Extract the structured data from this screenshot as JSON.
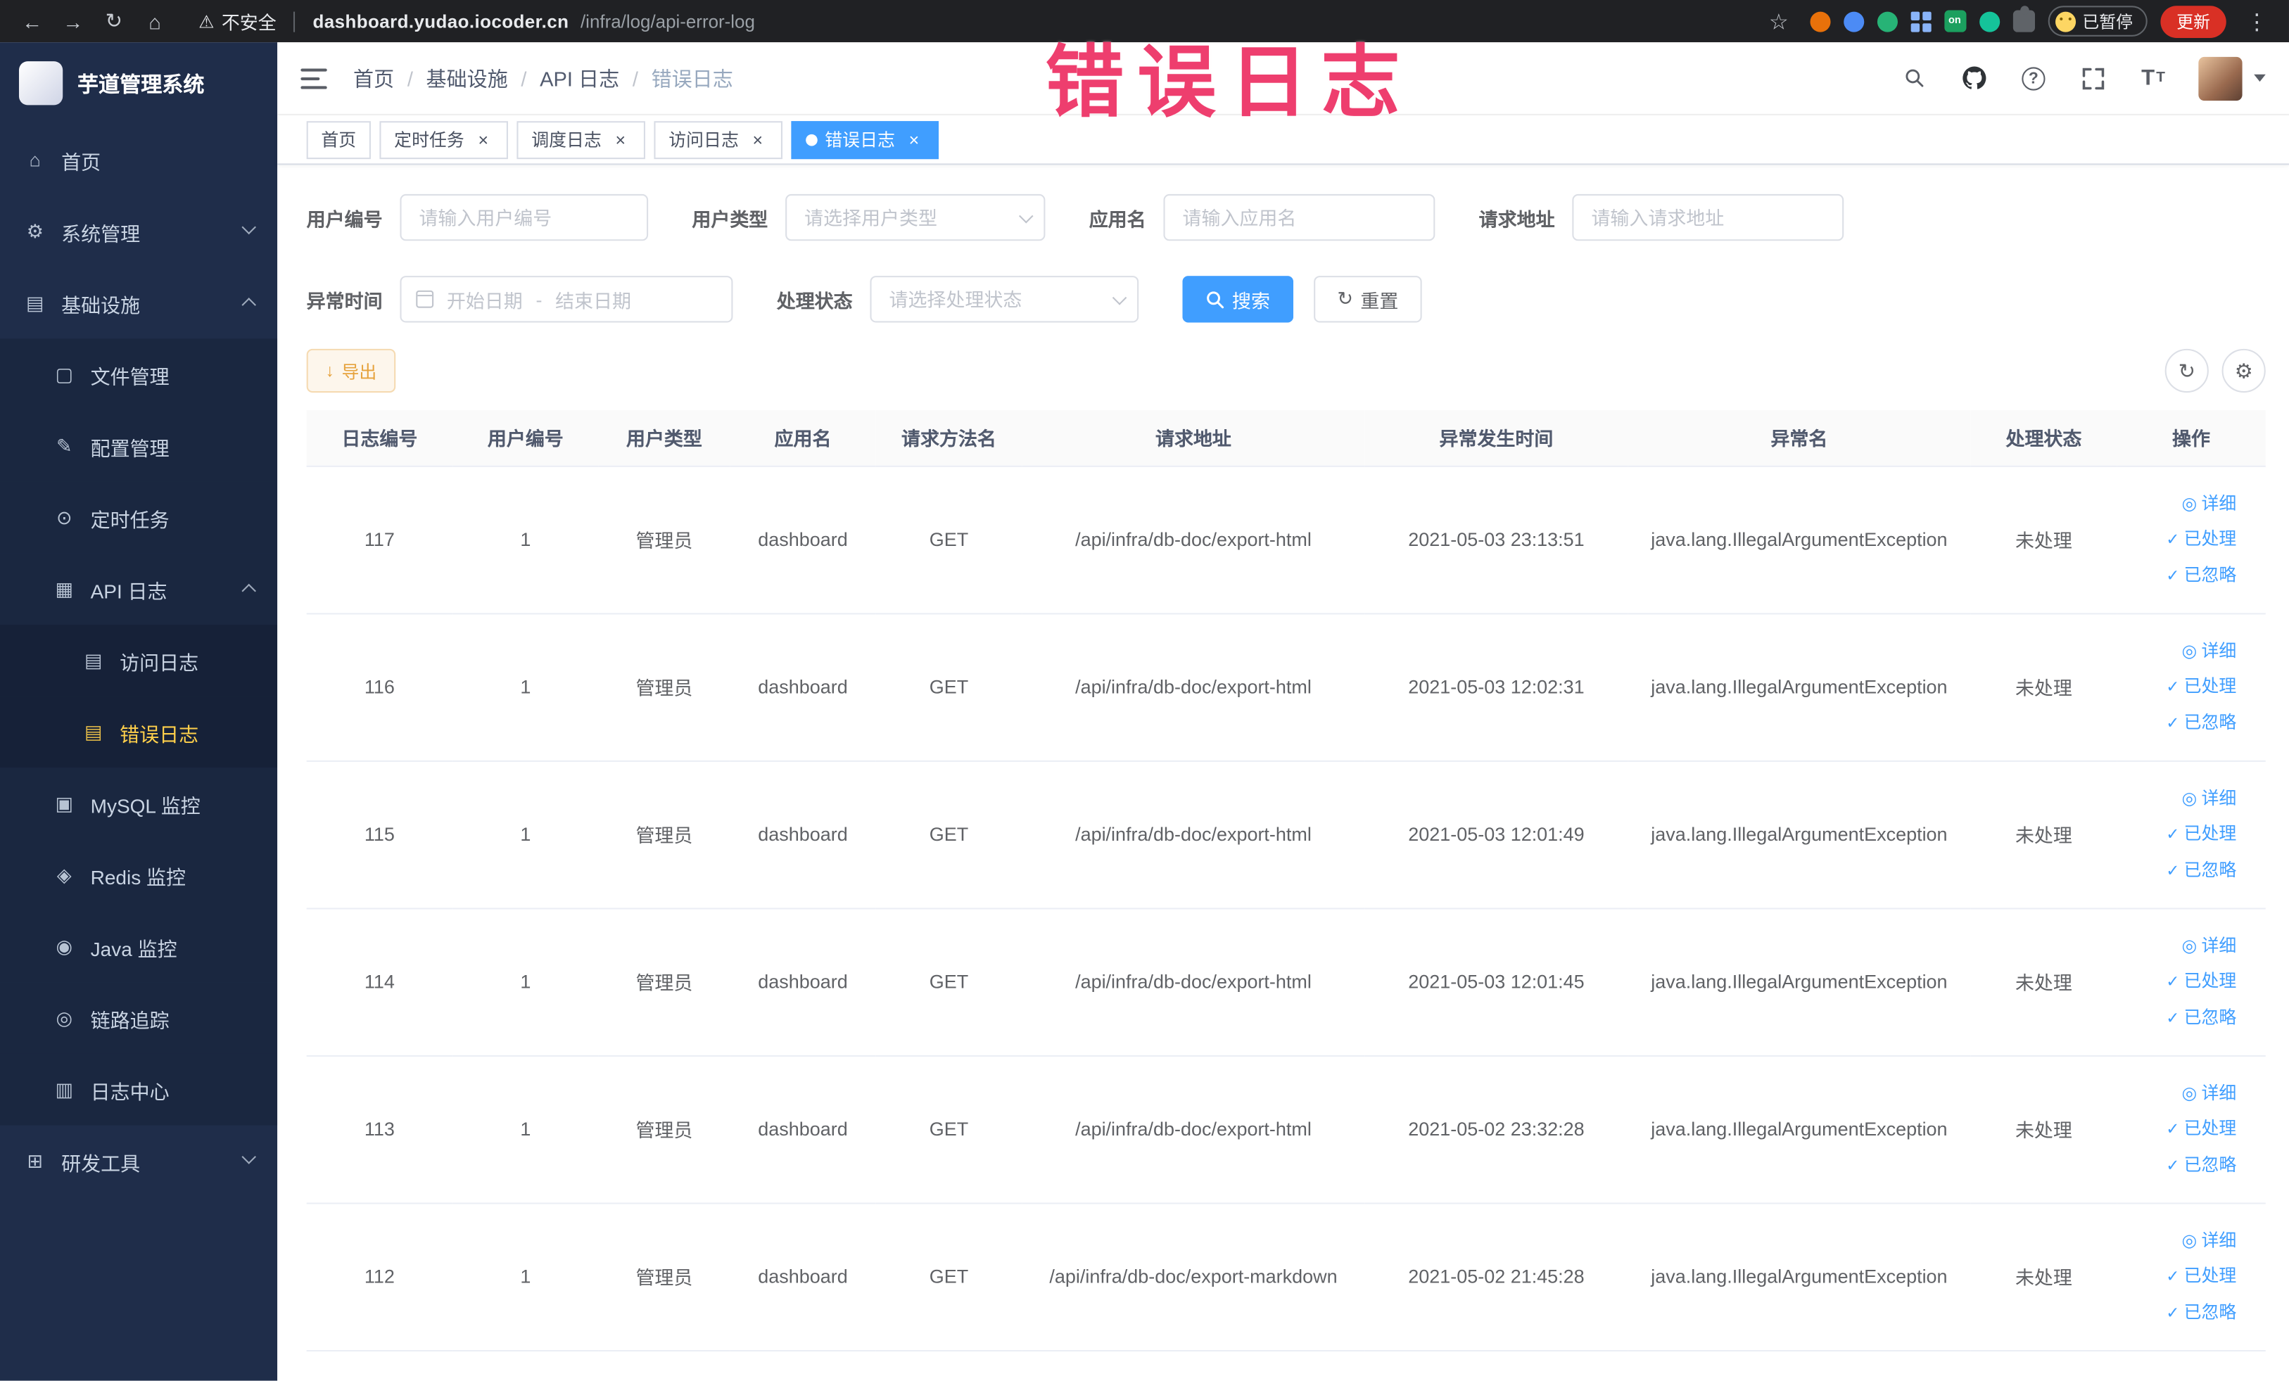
{
  "browser": {
    "security_label": "不安全",
    "url_host": "dashboard.yudao.iocoder.cn",
    "url_path": "/infra/log/api-error-log",
    "ext_on_badge": "on",
    "paused_badge": "已暂停",
    "update_label": "更新"
  },
  "overlay": {
    "title": "错误日志"
  },
  "sidebar": {
    "logo_text": "芋道管理系统",
    "items": [
      {
        "label": "首页"
      },
      {
        "label": "系统管理"
      },
      {
        "label": "基础设施"
      },
      {
        "label": "文件管理"
      },
      {
        "label": "配置管理"
      },
      {
        "label": "定时任务"
      },
      {
        "label": "API 日志"
      },
      {
        "label": "访问日志"
      },
      {
        "label": "错误日志"
      },
      {
        "label": "MySQL 监控"
      },
      {
        "label": "Redis 监控"
      },
      {
        "label": "Java 监控"
      },
      {
        "label": "链路追踪"
      },
      {
        "label": "日志中心"
      },
      {
        "label": "研发工具"
      }
    ]
  },
  "breadcrumb": {
    "items": [
      "首页",
      "基础设施",
      "API 日志",
      "错误日志"
    ],
    "separator": "/"
  },
  "tabs": {
    "items": [
      {
        "label": "首页"
      },
      {
        "label": "定时任务"
      },
      {
        "label": "调度日志"
      },
      {
        "label": "访问日志"
      },
      {
        "label": "错误日志"
      }
    ]
  },
  "filters": {
    "user_id": {
      "label": "用户编号",
      "placeholder": "请输入用户编号"
    },
    "user_type": {
      "label": "用户类型",
      "placeholder": "请选择用户类型"
    },
    "app_name": {
      "label": "应用名",
      "placeholder": "请输入应用名"
    },
    "request_url": {
      "label": "请求地址",
      "placeholder": "请输入请求地址"
    },
    "exception_time": {
      "label": "异常时间",
      "start_placeholder": "开始日期",
      "separator": "-",
      "end_placeholder": "结束日期"
    },
    "process_status": {
      "label": "处理状态",
      "placeholder": "请选择处理状态"
    },
    "search_label": "搜索",
    "reset_label": "重置"
  },
  "toolbar": {
    "export_label": "导出"
  },
  "table": {
    "columns": [
      "日志编号",
      "用户编号",
      "用户类型",
      "应用名",
      "请求方法名",
      "请求地址",
      "异常发生时间",
      "异常名",
      "处理状态",
      "操作"
    ],
    "actions": {
      "detail": "详细",
      "processed": "已处理",
      "ignored": "已忽略"
    },
    "rows": [
      {
        "id": "117",
        "user_id": "1",
        "user_type": "管理员",
        "app": "dashboard",
        "method": "GET",
        "url": "/api/infra/db-doc/export-html",
        "time": "2021-05-03 23:13:51",
        "exception": "java.lang.IllegalArgumentException",
        "status": "未处理"
      },
      {
        "id": "116",
        "user_id": "1",
        "user_type": "管理员",
        "app": "dashboard",
        "method": "GET",
        "url": "/api/infra/db-doc/export-html",
        "time": "2021-05-03 12:02:31",
        "exception": "java.lang.IllegalArgumentException",
        "status": "未处理"
      },
      {
        "id": "115",
        "user_id": "1",
        "user_type": "管理员",
        "app": "dashboard",
        "method": "GET",
        "url": "/api/infra/db-doc/export-html",
        "time": "2021-05-03 12:01:49",
        "exception": "java.lang.IllegalArgumentException",
        "status": "未处理"
      },
      {
        "id": "114",
        "user_id": "1",
        "user_type": "管理员",
        "app": "dashboard",
        "method": "GET",
        "url": "/api/infra/db-doc/export-html",
        "time": "2021-05-03 12:01:45",
        "exception": "java.lang.IllegalArgumentException",
        "status": "未处理"
      },
      {
        "id": "113",
        "user_id": "1",
        "user_type": "管理员",
        "app": "dashboard",
        "method": "GET",
        "url": "/api/infra/db-doc/export-html",
        "time": "2021-05-02 23:32:28",
        "exception": "java.lang.IllegalArgumentException",
        "status": "未处理"
      },
      {
        "id": "112",
        "user_id": "1",
        "user_type": "管理员",
        "app": "dashboard",
        "method": "GET",
        "url": "/api/infra/db-doc/export-markdown",
        "time": "2021-05-02 21:45:28",
        "exception": "java.lang.IllegalArgumentException",
        "status": "未处理"
      }
    ]
  }
}
